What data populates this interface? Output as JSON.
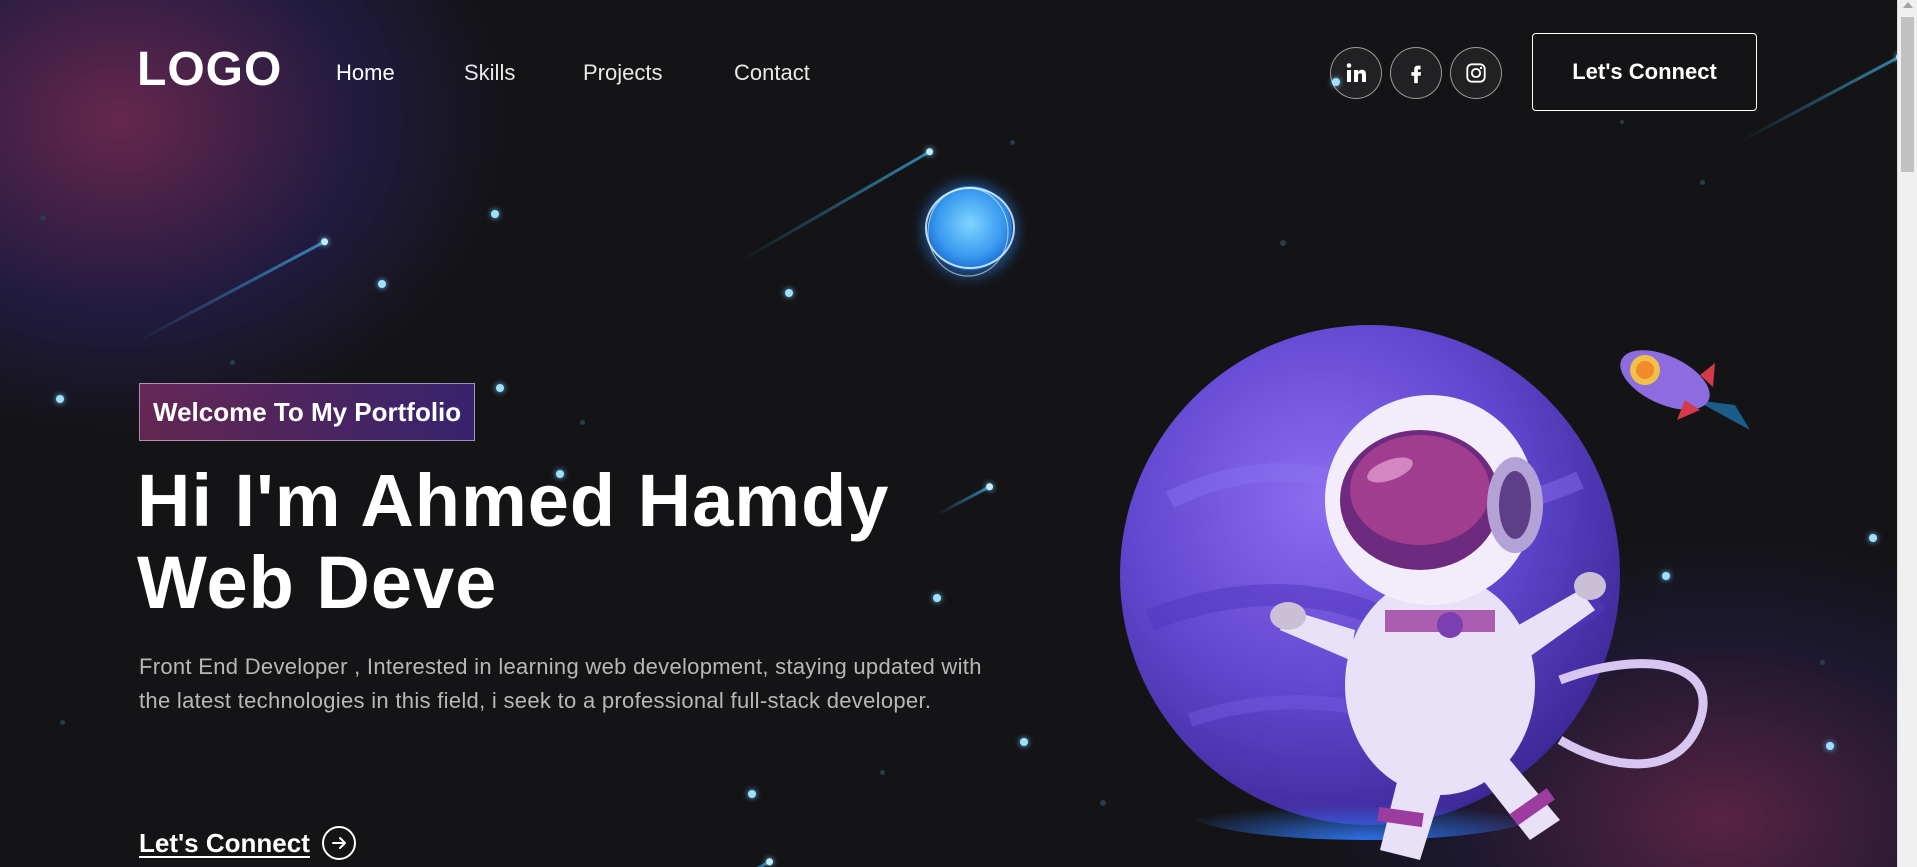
{
  "nav": {
    "logo": "LOGO",
    "links": [
      "Home",
      "Skills",
      "Projects",
      "Contact"
    ],
    "social_icons": [
      "linkedin-icon",
      "facebook-icon",
      "instagram-icon"
    ],
    "connect_label": "Let's Connect"
  },
  "hero": {
    "tagline": "Welcome To My Portfolio",
    "headline_line1": "Hi I'm Ahmed Hamdy",
    "headline_line2": "Web Deve",
    "description": "Front End Developer , Interested in learning web development, staying updated with the latest technologies in this field, i seek to a professional full-stack developer.",
    "cta_label": "Let's Connect"
  },
  "colors": {
    "background": "#121212",
    "accent_pink": "#AA367C",
    "accent_purple": "#4A2FBD",
    "planet": "#6a4fd8",
    "star": "#9fe0ff"
  }
}
